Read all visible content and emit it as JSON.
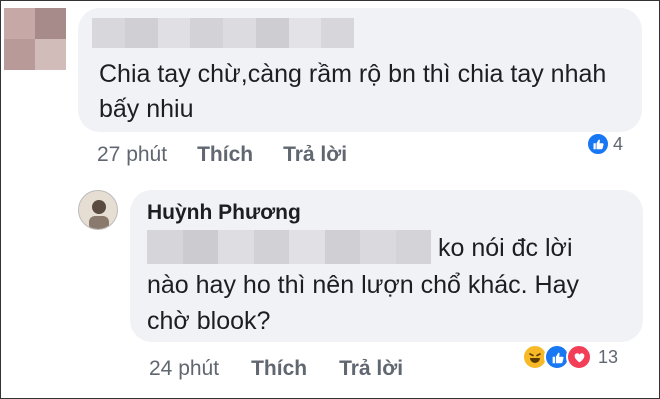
{
  "comment": {
    "text": "Chia tay chừ,càng rầm rộ bn thì chia tay nhah bấy nhiu",
    "time": "27 phút",
    "like_label": "Thích",
    "reply_label": "Trả lời",
    "reaction_count": "4",
    "reactions": [
      "like-icon"
    ]
  },
  "reply": {
    "author": "Huỳnh Phương",
    "text_line1": "ko nói đc lời",
    "text_rest": "nào hay ho thì nên lượn chổ khác. Hay chờ blook?",
    "time": "24 phút",
    "like_label": "Thích",
    "reply_label": "Trả lời",
    "reaction_count": "13",
    "reactions": [
      "haha-icon",
      "like-icon",
      "love-icon"
    ]
  },
  "colors": {
    "bubble": "#f0f2f5",
    "meta_text": "#606770",
    "like_blue": "#1877f2",
    "love_red": "#f33e58",
    "haha_yellow": "#f7b928"
  }
}
